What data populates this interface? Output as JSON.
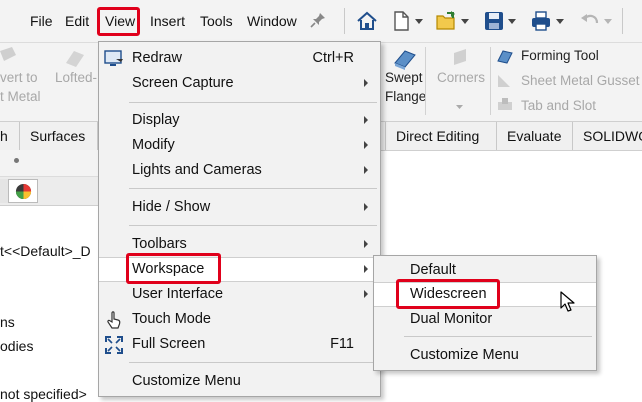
{
  "menubar": {
    "items": [
      "File",
      "Edit",
      "View",
      "Insert",
      "Tools",
      "Window"
    ],
    "highlighted": "View"
  },
  "toolbar": {
    "icons": [
      "pin-icon",
      "home-icon",
      "new-document-icon",
      "open-icon",
      "save-icon",
      "print-icon",
      "undo-icon"
    ]
  },
  "command_manager": {
    "left_ghost": [
      "vert to",
      "t Metal",
      "Lofted-"
    ],
    "swept_flange": [
      "Swept",
      "Flange"
    ],
    "corners": "Corners",
    "forming_tool": "Forming Tool",
    "sheet_metal_gusset": "Sheet Metal Gusset",
    "tab_and_slot": "Tab and Slot"
  },
  "tabs": {
    "left": [
      "h",
      "Surfaces"
    ],
    "right": [
      "Direct Editing",
      "Evaluate",
      "SOLIDWO"
    ]
  },
  "tree": {
    "items": [
      "t<<Default>_D",
      "ns",
      "odies",
      "not specified>"
    ]
  },
  "view_menu": {
    "items": [
      {
        "label": "Redraw",
        "shortcut": "Ctrl+R",
        "icon": "redraw-icon"
      },
      {
        "label": "Screen Capture",
        "submenu": true
      },
      {
        "label": "Display",
        "submenu": true
      },
      {
        "label": "Modify",
        "submenu": true
      },
      {
        "label": "Lights and Cameras",
        "submenu": true
      },
      {
        "label": "Hide / Show",
        "submenu": true
      },
      {
        "label": "Toolbars",
        "submenu": true
      },
      {
        "label": "Workspace",
        "submenu": true,
        "highlighted": true
      },
      {
        "label": "User Interface",
        "submenu": true
      },
      {
        "label": "Touch Mode",
        "icon": "touch-mode-icon"
      },
      {
        "label": "Full Screen",
        "shortcut": "F11",
        "icon": "full-screen-icon"
      },
      {
        "label": "Customize Menu"
      }
    ]
  },
  "workspace_menu": {
    "items": [
      "Default",
      "Widescreen",
      "Dual Monitor",
      "Customize Menu"
    ],
    "highlighted": "Widescreen"
  },
  "colors": {
    "highlight_box": "#e0001b",
    "menu_bg": "#f2f2f2",
    "hover_bg": "#ffffff"
  }
}
